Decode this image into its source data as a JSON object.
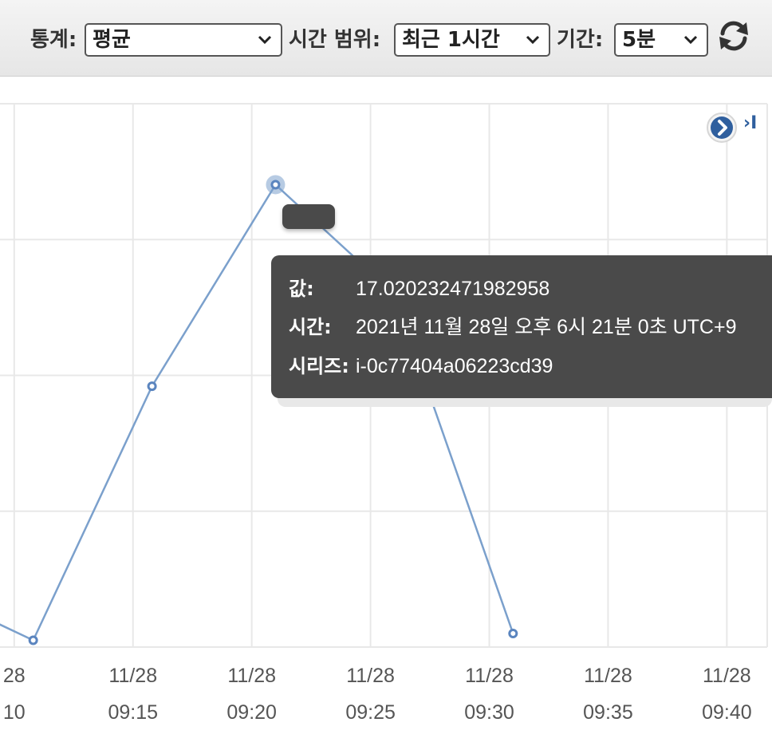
{
  "toolbar": {
    "statistic_label": "통계:",
    "statistic_value": "평균",
    "time_range_label": "시간 범위:",
    "time_range_value": "최근 1시간",
    "period_label": "기간:",
    "period_value": "5분",
    "refresh_icon": "refresh-icon"
  },
  "chart_nav": {
    "next_icon": "next-arrow-icon",
    "end_label": "›I"
  },
  "tooltip": {
    "value_key": "값:",
    "value": "17.020232471982958",
    "time_key": "시간:",
    "time": "2021년 11월 28일 오후 6시 21분 0초 UTC+9",
    "series_key": "시리즈:",
    "series": "i-0c77404a06223cd39"
  },
  "colors": {
    "line": "#7ba0cc",
    "point": "#5b85bf",
    "grid": "#e8e8e8",
    "tooltip_bg": "#4a4a4a"
  },
  "chart_data": {
    "type": "line",
    "x_ticks": [
      {
        "date": "28",
        "time": "10"
      },
      {
        "date": "11/28",
        "time": "09:15"
      },
      {
        "date": "11/28",
        "time": "09:20"
      },
      {
        "date": "11/28",
        "time": "09:25"
      },
      {
        "date": "11/28",
        "time": "09:30"
      },
      {
        "date": "11/28",
        "time": "09:35"
      },
      {
        "date": "11/28",
        "time": "09:40"
      }
    ],
    "series": [
      {
        "points": [
          {
            "t": 8.5,
            "v": 1.2
          },
          {
            "t": 10.8,
            "v": 0.25
          },
          {
            "t": 15.8,
            "v": 9.6
          },
          {
            "t": 21.0,
            "v": 17.02
          },
          {
            "t": 26.0,
            "v": 13.0
          },
          {
            "t": 31.0,
            "v": 0.5
          }
        ],
        "marker_times": [
          10.8,
          15.8,
          21.0,
          31.0
        ],
        "highlight_time": 21.0
      }
    ],
    "x_range": [
      9.2,
      41.7
    ],
    "y_range": [
      0,
      20
    ],
    "grid": true
  }
}
